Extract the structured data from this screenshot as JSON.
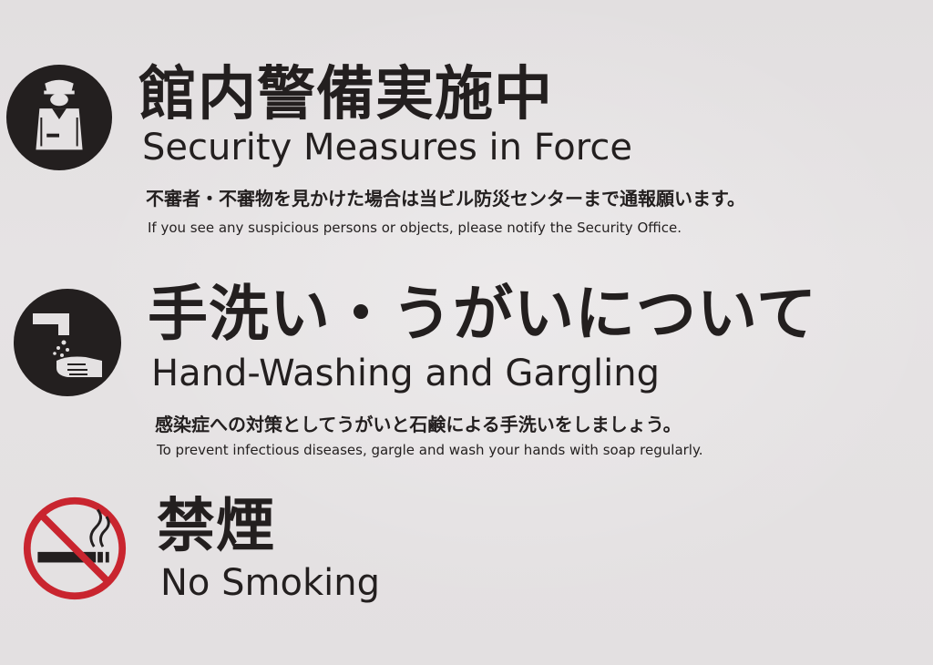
{
  "colors": {
    "background": "#e4e1e2",
    "ink": "#231f1f",
    "no_smoking_red": "#c9252f"
  },
  "signs": [
    {
      "icon": "security-guard-icon",
      "title_jp": "館内警備実施中",
      "title_en": "Security Measures in Force",
      "note_jp": "不審者・不審物を見かけた場合は当ビル防災センターまで通報願います。",
      "note_en": "If you see any suspicious persons or objects, please notify the Security Office."
    },
    {
      "icon": "hand-washing-icon",
      "title_jp": "手洗い・うがいについて",
      "title_en": "Hand-Washing and Gargling",
      "note_jp": "感染症への対策としてうがいと石鹸による手洗いをしましょう。",
      "note_en": "To prevent infectious diseases, gargle and wash your hands with soap regularly."
    },
    {
      "icon": "no-smoking-icon",
      "title_jp": "禁煙",
      "title_en": "No Smoking"
    }
  ]
}
